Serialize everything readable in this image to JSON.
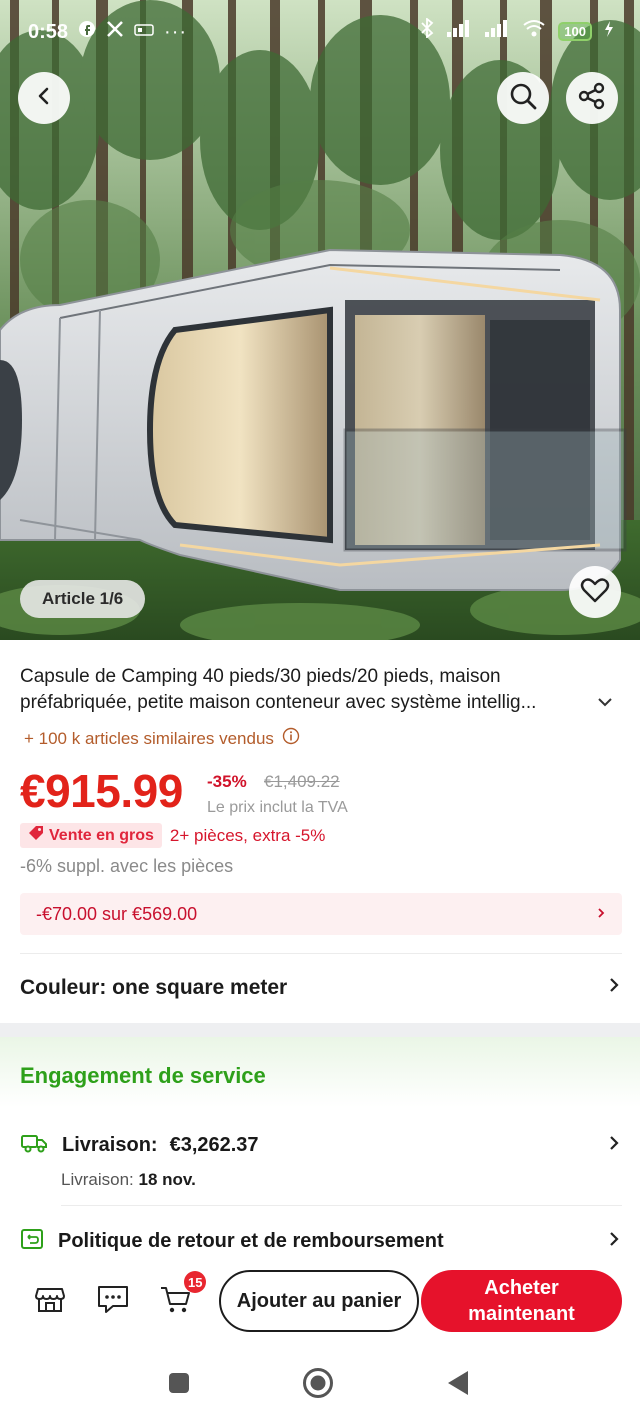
{
  "status_bar": {
    "time": "0:58",
    "battery": "100",
    "icons": [
      "facebook-icon",
      "x-icon",
      "nfc-icon",
      "more-dots-icon",
      "bluetooth-icon",
      "signal-icon",
      "signal-icon",
      "wifi-icon",
      "battery-icon",
      "charging-icon"
    ]
  },
  "hero": {
    "article_counter": "Article 1/6",
    "icons": [
      "back-arrow-icon",
      "search-icon",
      "share-icon",
      "heart-icon"
    ]
  },
  "product": {
    "title_line1": "Capsule de Camping 40 pieds/30 pieds/20 pieds, maison",
    "title_line2": "préfabriquée, petite maison conteneur avec système intellig...",
    "sold": "+ 100 k articles similaires vendus",
    "price": "€915.99",
    "discount": "-35%",
    "old_price": "€1,409.22",
    "vat_note": "Le prix inclut la TVA",
    "wholesale_tag": "Vente en gros",
    "wholesale_offer": "2+ pièces, extra -5%",
    "extra_discount": "-6% suppl. avec les pièces",
    "coupon": "-€70.00 sur €569.00",
    "color_row": "Couleur: one square meter"
  },
  "service": {
    "title": "Engagement de service",
    "shipping_label": "Livraison:",
    "shipping_price": "€3,262.37",
    "delivery_label": "Livraison:",
    "delivery_date": "18 nov.",
    "return_policy": "Politique de retour et de remboursement"
  },
  "bottom_bar": {
    "cart_count": "15",
    "add_to_cart": "Ajouter au panier",
    "buy_now": "Acheter maintenant",
    "icons": [
      "store-icon",
      "chat-icon",
      "cart-icon"
    ]
  },
  "colors": {
    "accent_red": "#e6122b",
    "price_red": "#e2231a",
    "service_green": "#2ea01a",
    "sold_orange": "#b35c2b"
  }
}
